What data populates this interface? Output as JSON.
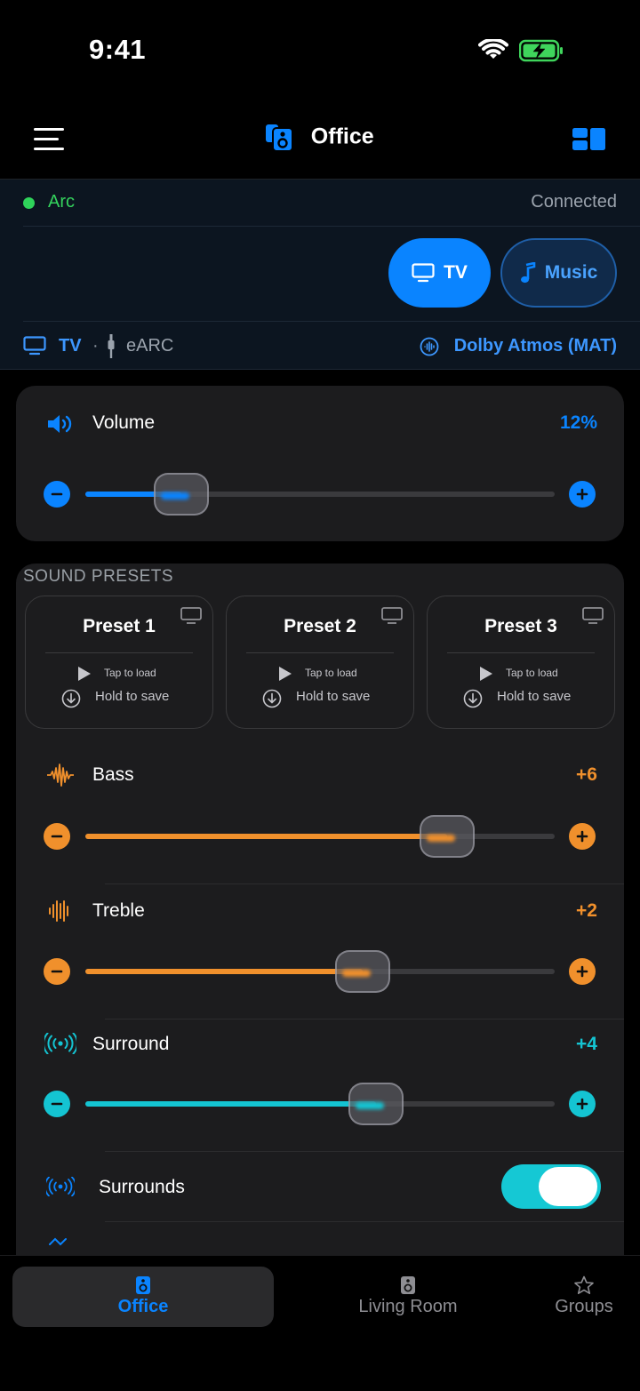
{
  "status_bar": {
    "time": "9:41"
  },
  "nav": {
    "title": "Office"
  },
  "device": {
    "name": "Arc",
    "status": "Connected",
    "sources": [
      {
        "label": "TV",
        "active": true
      },
      {
        "label": "Music",
        "active": false
      }
    ],
    "connection": {
      "input": "TV",
      "separator": "·",
      "port": "eARC",
      "format": "Dolby Atmos (MAT)"
    }
  },
  "volume": {
    "label": "Volume",
    "value_text": "12%",
    "level_percent": 12,
    "accent": "#0a84ff"
  },
  "presets": {
    "title": "SOUND PRESETS",
    "items": [
      {
        "name": "Preset 1",
        "tap": "Tap to load",
        "hold": "Hold to save"
      },
      {
        "name": "Preset 2",
        "tap": "Tap to load",
        "hold": "Hold to save"
      },
      {
        "name": "Preset 3",
        "tap": "Tap to load",
        "hold": "Hold to save"
      }
    ]
  },
  "eq": {
    "bass": {
      "label": "Bass",
      "value_text": "+6",
      "level_fraction": 0.77,
      "accent": "#f0902c"
    },
    "treble": {
      "label": "Treble",
      "value_text": "+2",
      "level_fraction": 0.59,
      "accent": "#f0902c"
    },
    "surround": {
      "label": "Surround",
      "value_text": "+4",
      "level_fraction": 0.62,
      "accent": "#14c4d2"
    }
  },
  "surrounds_toggle": {
    "label": "Surrounds",
    "on": true
  },
  "tabs": [
    {
      "label": "Office",
      "active": true
    },
    {
      "label": "Living Room",
      "active": false
    },
    {
      "label": "Groups",
      "active": false
    }
  ],
  "colors": {
    "accent_blue": "#0a84ff",
    "connected_green": "#34d35d",
    "eq_orange": "#f0902c",
    "surround_cyan": "#14c4d2"
  }
}
